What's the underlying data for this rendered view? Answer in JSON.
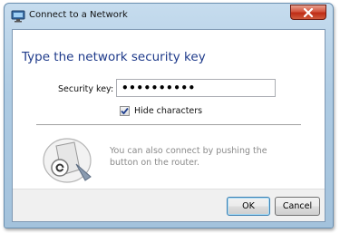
{
  "window": {
    "title": "Connect to a Network"
  },
  "dialog": {
    "heading": "Type the network security key",
    "security_key_label": "Security key:",
    "security_key_value": "••••••••••",
    "hide_characters_label": "Hide characters",
    "hide_characters_checked": true,
    "router_hint": "You can also connect by pushing the button on the router."
  },
  "buttons": {
    "ok_label": "OK",
    "cancel_label": "Cancel"
  },
  "icons": {
    "app": "network-icon",
    "close": "close-icon",
    "router": "router-push-button-icon"
  },
  "colors": {
    "heading": "#1e3a8a",
    "close_button": "#c83a22",
    "hint_text": "#8a8a8a"
  }
}
